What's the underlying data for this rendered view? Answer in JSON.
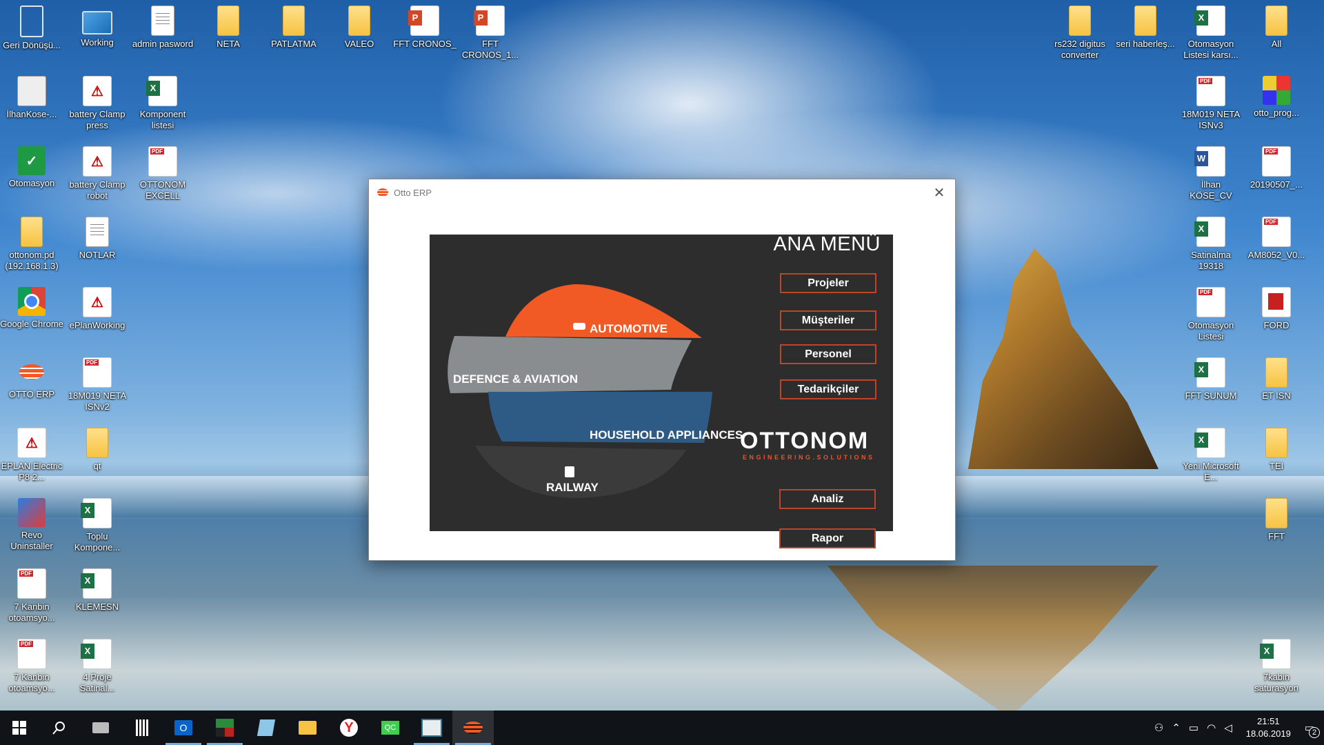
{
  "desktop": {
    "icons": [
      {
        "label": "Geri Dönüşü...",
        "icon": "recycle-bin-icon"
      },
      {
        "label": "Working",
        "icon": "monitor-icon"
      },
      {
        "label": "admin pasword",
        "icon": "text-file-icon"
      },
      {
        "label": "NETA",
        "icon": "folder-icon"
      },
      {
        "label": "PATLATMA",
        "icon": "folder-icon"
      },
      {
        "label": "VALEO",
        "icon": "folder-icon"
      },
      {
        "label": "FFT CRONOS_",
        "icon": "powerpoint-icon"
      },
      {
        "label": "FFT CRONOS_1...",
        "icon": "powerpoint-icon"
      },
      {
        "label": "rs232 digitus converter",
        "icon": "folder-icon"
      },
      {
        "label": "seri haberleş...",
        "icon": "folder-icon"
      },
      {
        "label": "Otomasyon Listesi karsı...",
        "icon": "excel-icon"
      },
      {
        "label": "All",
        "icon": "folder-icon"
      },
      {
        "label": "İlhanKose-...",
        "icon": "network-icon"
      },
      {
        "label": "battery Clamp press",
        "icon": "eplan-icon"
      },
      {
        "label": "Komponent listesi",
        "icon": "excel-icon"
      },
      {
        "label": "18M019 NETA ISNv3",
        "icon": "pdf-icon"
      },
      {
        "label": "otto_prog...",
        "icon": "app-icon"
      },
      {
        "label": "Otomasyon",
        "icon": "shield-icon"
      },
      {
        "label": "battery Clamp robot",
        "icon": "eplan-icon"
      },
      {
        "label": "OTTONOM EXCELL",
        "icon": "pdf-icon"
      },
      {
        "label": "İlhan KÖSE_CV",
        "icon": "word-icon"
      },
      {
        "label": "20190507_...",
        "icon": "pdf-icon"
      },
      {
        "label": "ottonom.pd (192.168.1.3)",
        "icon": "network-folder-icon"
      },
      {
        "label": "NOTLAR",
        "icon": "text-file-icon"
      },
      {
        "label": "Satinalma 19318",
        "icon": "excel-icon"
      },
      {
        "label": "AM8052_V0...",
        "icon": "pdf-icon"
      },
      {
        "label": "Google Chrome",
        "icon": "chrome-icon"
      },
      {
        "label": "ePlanWorking",
        "icon": "eplan-icon"
      },
      {
        "label": "Otomasyon Listesi",
        "icon": "pdf-icon"
      },
      {
        "label": "FORD",
        "icon": "red-file-icon"
      },
      {
        "label": "OTTO ERP",
        "icon": "otto-erp-icon"
      },
      {
        "label": "18M019 NETA ISNv2",
        "icon": "pdf-icon"
      },
      {
        "label": "FFT SUNUM",
        "icon": "excel-icon"
      },
      {
        "label": "ET ISN",
        "icon": "folder-icon"
      },
      {
        "label": "EPLAN Electric P8 2...",
        "icon": "eplan-icon"
      },
      {
        "label": "qt",
        "icon": "folder-icon"
      },
      {
        "label": "Yeni Microsoft E...",
        "icon": "excel-icon"
      },
      {
        "label": "TEI",
        "icon": "folder-icon"
      },
      {
        "label": "Revo Uninstaller",
        "icon": "revo-icon"
      },
      {
        "label": "Toplu Kompone...",
        "icon": "excel-icon"
      },
      {
        "label": "FFT",
        "icon": "folder-icon"
      },
      {
        "label": "7 Kanbin otoamsyo...",
        "icon": "pdf-icon"
      },
      {
        "label": "KLEMESN",
        "icon": "excel-icon"
      },
      {
        "label": "7 Kanbin otoamsyo...",
        "icon": "pdf-icon"
      },
      {
        "label": "4 Proje Satinal...",
        "icon": "excel-icon"
      },
      {
        "label": "7kabin saturasyon",
        "icon": "excel-icon"
      }
    ]
  },
  "window": {
    "title": "Otto ERP",
    "close_glyph": "✕",
    "menu_title": "ANA MENÜ",
    "buttons": {
      "projeler": "Projeler",
      "musteriler": "Müşteriler",
      "personel": "Personel",
      "tedarikciler": "Tedarikçiler",
      "analiz": "Analiz",
      "rapor": "Rapor"
    },
    "logo": {
      "automotive": "AUTOMOTIVE",
      "defence": "DEFENCE & AVIATION",
      "household": "HOUSEHOLD APPLIANCES",
      "railway": "RAILWAY",
      "brand": "OTTONOM",
      "brand_sub": "ENGINEERING.SOLUTIONS"
    },
    "colors": {
      "accent": "#f15a24",
      "panel": "#2d2d2d",
      "button_border": "#c0442a"
    }
  },
  "taskbar": {
    "items": [
      "windows-start-icon",
      "search-icon",
      "printer-icon",
      "calculator-icon",
      "outlook-icon",
      "app-icon",
      "notepad-icon",
      "file-explorer-icon",
      "yandex-browser-icon",
      "qt-creator-icon",
      "window-app-icon",
      "otto-erp-icon"
    ],
    "time": "21:51",
    "date": "18.06.2019",
    "notification_count": "2"
  }
}
